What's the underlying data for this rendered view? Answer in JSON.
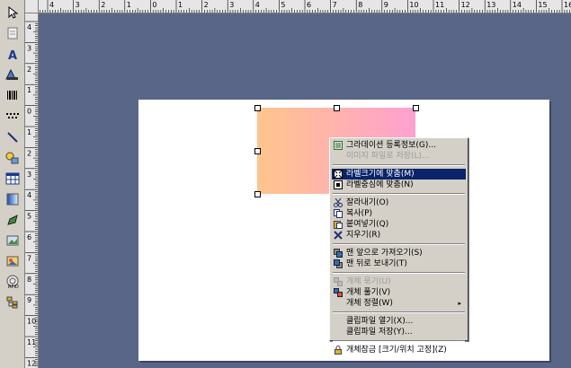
{
  "ruler": {
    "top_labels": [
      "4",
      "3",
      "2",
      "1",
      "0",
      "1",
      "2",
      "3",
      "4",
      "5",
      "6",
      "7",
      "8",
      "9",
      "10",
      "11",
      "12",
      "13",
      "14",
      "15",
      "16"
    ],
    "left_labels": [
      "4",
      "3",
      "2",
      "1",
      "0",
      "1",
      "2",
      "3",
      "4",
      "5",
      "6",
      "7",
      "8",
      "9",
      "10",
      "11",
      "12"
    ]
  },
  "toolbar": {
    "tools": [
      "select-arrow-icon",
      "page-icon",
      "text-icon",
      "text-outline-icon",
      "barcode-icon",
      "barcode2-icon",
      "line-icon",
      "shapes-icon",
      "table-icon",
      "gradient-icon",
      "pen-icon",
      "image-icon",
      "image2-icon",
      "rfid-icon",
      "tree-icon"
    ]
  },
  "menu": {
    "items": [
      {
        "label": "그라데이션 등록정보(G)...",
        "state": "normal",
        "icon": "properties-icon"
      },
      {
        "label": "이미지 파일로 저장(L)...",
        "state": "disabled",
        "icon": ""
      },
      {
        "label": "라벨크기에 맞춤(M)",
        "state": "selected",
        "icon": "fit-label-icon"
      },
      {
        "label": "라벨중심에 맞춤(N)",
        "state": "normal",
        "icon": "center-label-icon"
      },
      {
        "label": "잘라내기(O)",
        "state": "normal",
        "icon": "cut-icon"
      },
      {
        "label": "복사(P)",
        "state": "normal",
        "icon": "copy-icon"
      },
      {
        "label": "붙여넣기(Q)",
        "state": "normal",
        "icon": "paste-icon"
      },
      {
        "label": "지우기(R)",
        "state": "normal",
        "icon": "delete-icon"
      },
      {
        "label": "맨 앞으로 가져오기(S)",
        "state": "normal",
        "icon": "bring-front-icon"
      },
      {
        "label": "맨 뒤로 보내기(T)",
        "state": "normal",
        "icon": "send-back-icon"
      },
      {
        "label": "개체 묶기(U)",
        "state": "disabled",
        "icon": "group-icon"
      },
      {
        "label": "개체 풀기(V)",
        "state": "normal",
        "icon": "ungroup-icon"
      },
      {
        "label": "개체 정렬(W)",
        "state": "normal",
        "icon": "",
        "submenu_arrow": "▸"
      },
      {
        "label": "클립파일 열기(X)...",
        "state": "normal",
        "icon": ""
      },
      {
        "label": "클립파일 저장(Y)...",
        "state": "normal",
        "icon": ""
      },
      {
        "label": "개체잠금 [크기/위치 고정](Z)",
        "state": "normal",
        "icon": "lock-icon"
      }
    ]
  }
}
